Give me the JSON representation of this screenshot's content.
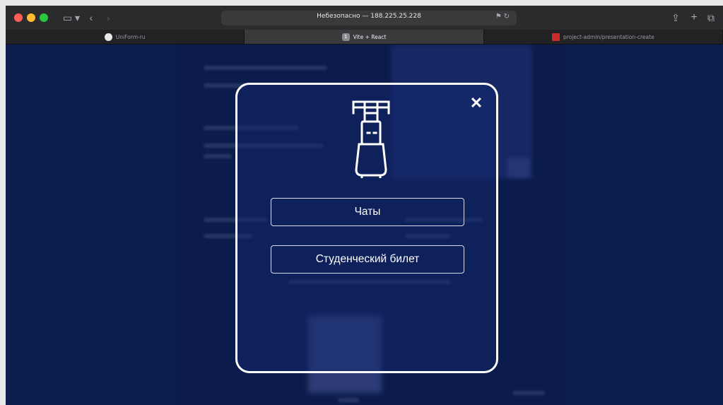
{
  "browser": {
    "address": "Небезопасно — 188.225.25.228",
    "tabs": [
      {
        "label": "UniForm-ru",
        "active": false
      },
      {
        "label": "Vite + React",
        "badge": "1",
        "active": true
      },
      {
        "label": "project-admin/presentation-create",
        "active": false
      }
    ]
  },
  "modal": {
    "close_icon": "close-icon",
    "logo_icon": "robot-logo-icon",
    "buttons": {
      "chats": "Чаты",
      "student_ticket": "Студенческий билет"
    }
  },
  "colors": {
    "page_background": "#0a1b4b",
    "modal_border": "#ffffff",
    "button_border": "#d9dcf0"
  }
}
